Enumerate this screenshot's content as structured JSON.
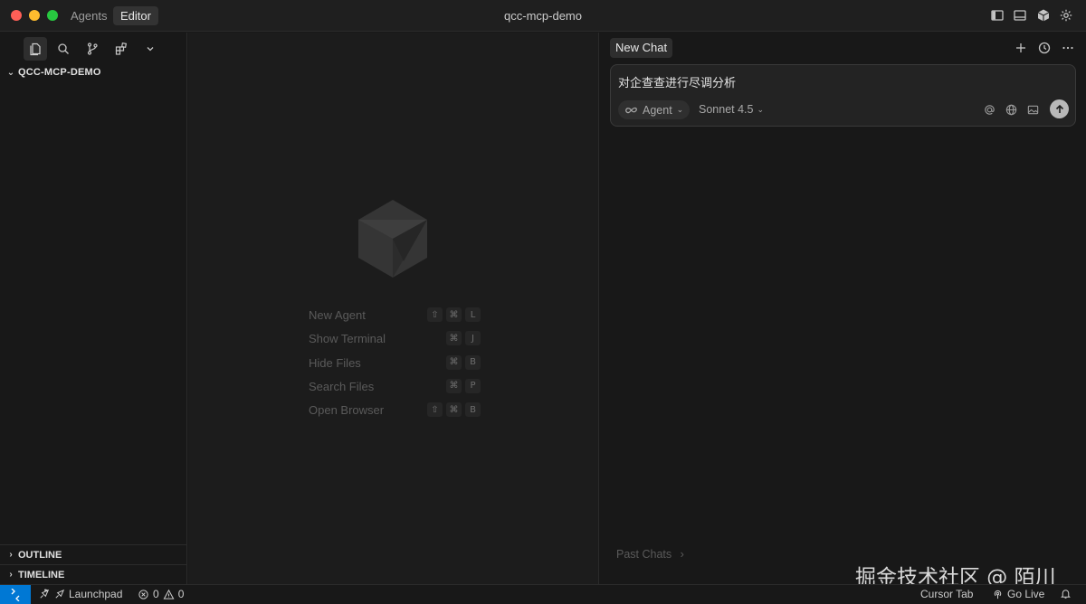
{
  "window": {
    "title": "qcc-mcp-demo",
    "mode_tabs": [
      "Agents",
      "Editor"
    ],
    "active_mode": "Editor"
  },
  "titlebar_icons": [
    "sidebar-toggle-icon",
    "panel-toggle-icon",
    "cube-icon",
    "gear-icon"
  ],
  "sidebar": {
    "activity_icons": [
      "files-icon",
      "search-icon",
      "source-control-icon",
      "extensions-icon",
      "chevron-down-icon"
    ],
    "explorer_title": "QCC-MCP-DEMO",
    "sections": [
      "OUTLINE",
      "TIMELINE"
    ]
  },
  "editor": {
    "shortcuts": [
      {
        "label": "New Agent",
        "keys": [
          "⇧",
          "⌘",
          "L"
        ]
      },
      {
        "label": "Show Terminal",
        "keys": [
          "⌘",
          "J"
        ]
      },
      {
        "label": "Hide Files",
        "keys": [
          "⌘",
          "B"
        ]
      },
      {
        "label": "Search Files",
        "keys": [
          "⌘",
          "P"
        ]
      },
      {
        "label": "Open Browser",
        "keys": [
          "⇧",
          "⌘",
          "B"
        ]
      }
    ]
  },
  "chat": {
    "tab_label": "New Chat",
    "composer": {
      "prompt_text": "对企查查进行尽调分析",
      "mode_label": "Agent",
      "model_label": "Sonnet 4.5"
    },
    "past_chats_label": "Past Chats",
    "watermark": "掘金技术社区 @ 陌川"
  },
  "statusbar": {
    "launchpad_label": "Launchpad",
    "errors": "0",
    "warnings": "0",
    "cursor_tab_label": "Cursor Tab",
    "go_live_label": "Go Live"
  },
  "colors": {
    "accent": "#0078d4",
    "background": "#181818",
    "editor_background": "#1c1c1c"
  }
}
